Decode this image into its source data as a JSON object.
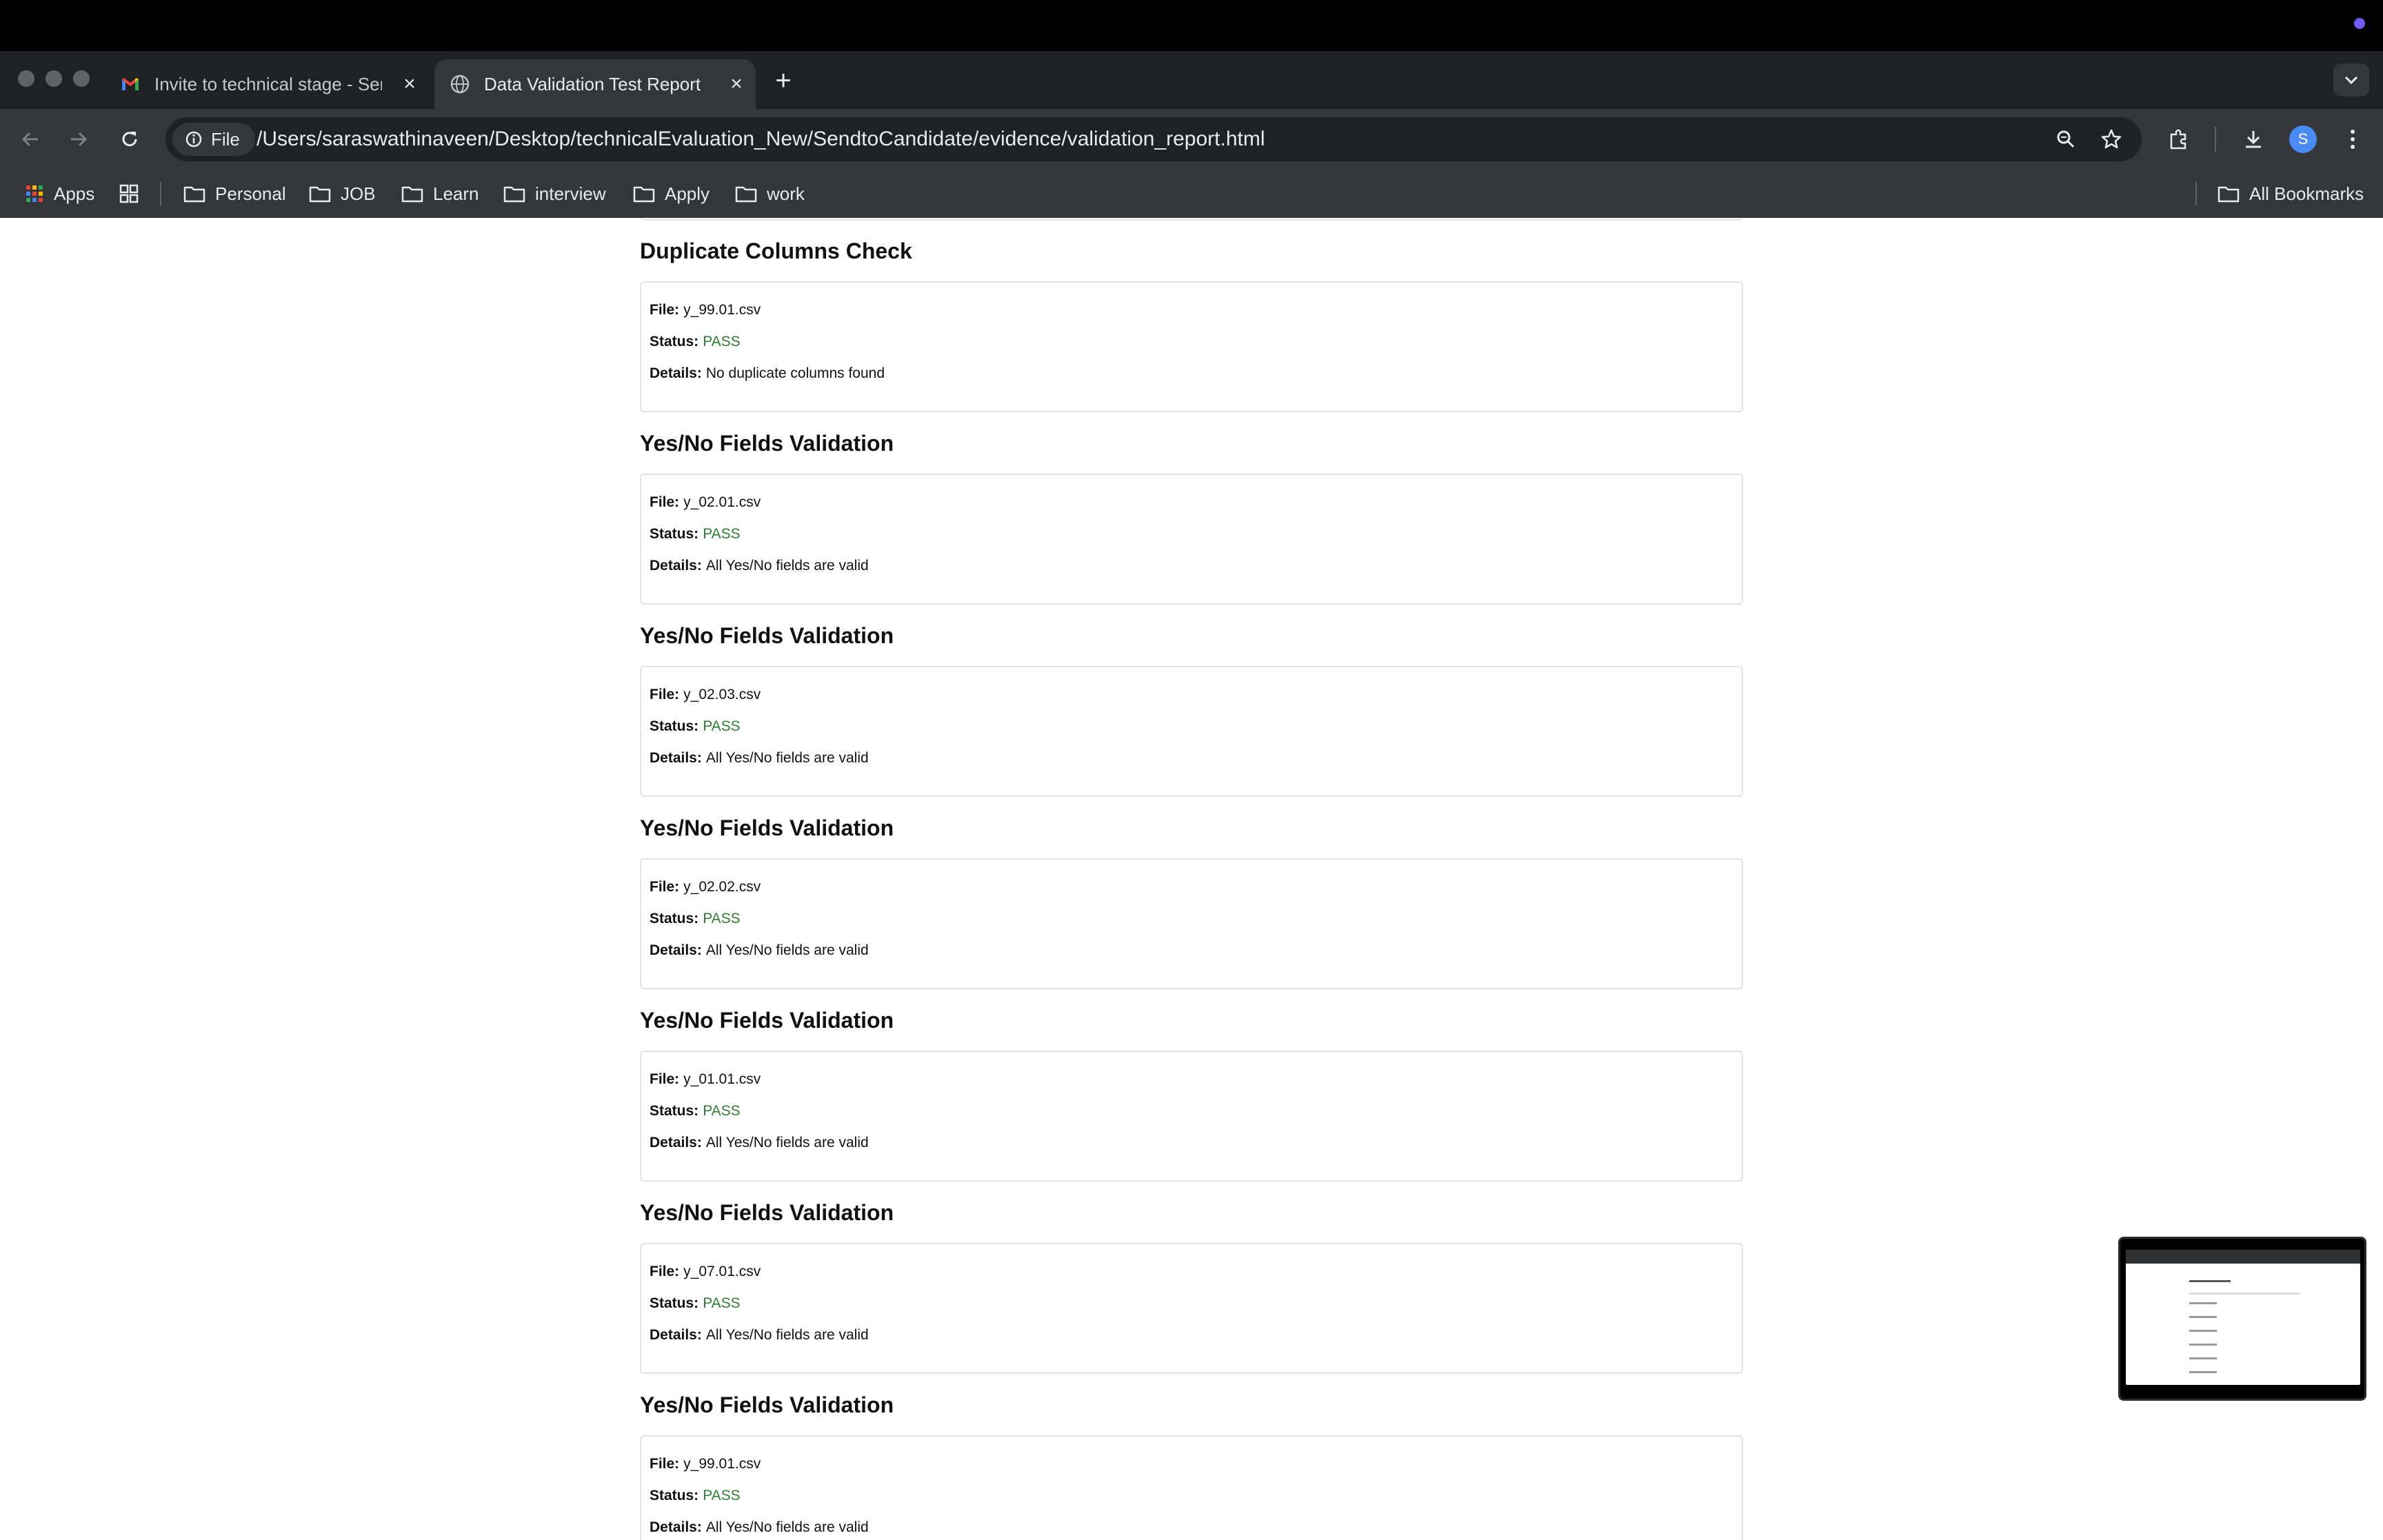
{
  "browser": {
    "tabs": [
      {
        "title": "Invite to technical stage - Ser",
        "favicon": "gmail-icon",
        "active": false
      },
      {
        "title": "Data Validation Test Report",
        "favicon": "globe-icon",
        "active": true
      }
    ],
    "address_chip": "File",
    "url": "/Users/saraswathinaveen/Desktop/technicalEvaluation_New/SendtoCandidate/evidence/validation_report.html",
    "profile_initial": "S",
    "bookmarks": [
      {
        "label": "Apps",
        "icon": "apps-grid-icon"
      },
      {
        "label": "Personal",
        "icon": "folder-icon"
      },
      {
        "label": "JOB",
        "icon": "folder-icon"
      },
      {
        "label": "Learn",
        "icon": "folder-icon"
      },
      {
        "label": "interview",
        "icon": "folder-icon"
      },
      {
        "label": "Apply",
        "icon": "folder-icon"
      },
      {
        "label": "work",
        "icon": "folder-icon"
      }
    ],
    "all_bookmarks_label": "All Bookmarks"
  },
  "labels": {
    "file": "File:",
    "status": "Status:",
    "details": "Details:"
  },
  "colors": {
    "pass": "#2e7d32",
    "accent_dot": "#6f5cf6"
  },
  "report": {
    "sections": [
      {
        "heading": "Duplicate Columns Check",
        "file": "y_99.01.csv",
        "status": "PASS",
        "details": "No duplicate columns found"
      },
      {
        "heading": "Yes/No Fields Validation",
        "file": "y_02.01.csv",
        "status": "PASS",
        "details": "All Yes/No fields are valid"
      },
      {
        "heading": "Yes/No Fields Validation",
        "file": "y_02.03.csv",
        "status": "PASS",
        "details": "All Yes/No fields are valid"
      },
      {
        "heading": "Yes/No Fields Validation",
        "file": "y_02.02.csv",
        "status": "PASS",
        "details": "All Yes/No fields are valid"
      },
      {
        "heading": "Yes/No Fields Validation",
        "file": "y_01.01.csv",
        "status": "PASS",
        "details": "All Yes/No fields are valid"
      },
      {
        "heading": "Yes/No Fields Validation",
        "file": "y_07.01.csv",
        "status": "PASS",
        "details": "All Yes/No fields are valid"
      },
      {
        "heading": "Yes/No Fields Validation",
        "file": "y_99.01.csv",
        "status": "PASS",
        "details": "All Yes/No fields are valid"
      }
    ]
  }
}
